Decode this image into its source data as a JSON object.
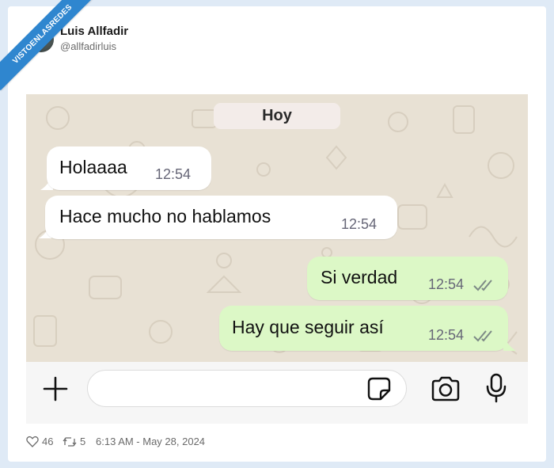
{
  "watermark": {
    "text": "VISTOENLASREDES"
  },
  "tweet": {
    "author_name": "Luis Allfadir",
    "author_handle": "@allfadirluis",
    "likes": "46",
    "retweets": "5",
    "timestamp": "6:13 AM - May 28, 2024"
  },
  "chat": {
    "date_label": "Hoy",
    "messages": [
      {
        "direction": "incoming",
        "text": "Holaaaa",
        "time": "12:54"
      },
      {
        "direction": "incoming",
        "text": "Hace mucho no hablamos",
        "time": "12:54"
      },
      {
        "direction": "outgoing",
        "text": "Si verdad",
        "time": "12:54",
        "status": "read-double-check"
      },
      {
        "direction": "outgoing",
        "text": "Hay que seguir así",
        "time": "12:54",
        "status": "read-double-check"
      }
    ],
    "composer": {
      "placeholder": ""
    },
    "icons": [
      "plus-icon",
      "sticker-icon",
      "camera-icon",
      "microphone-icon"
    ]
  },
  "colors": {
    "outgoing_bubble": "#dcf8c6",
    "incoming_bubble": "#ffffff",
    "chat_background": "#e8e1d4",
    "ribbon": "#2f86cf"
  }
}
